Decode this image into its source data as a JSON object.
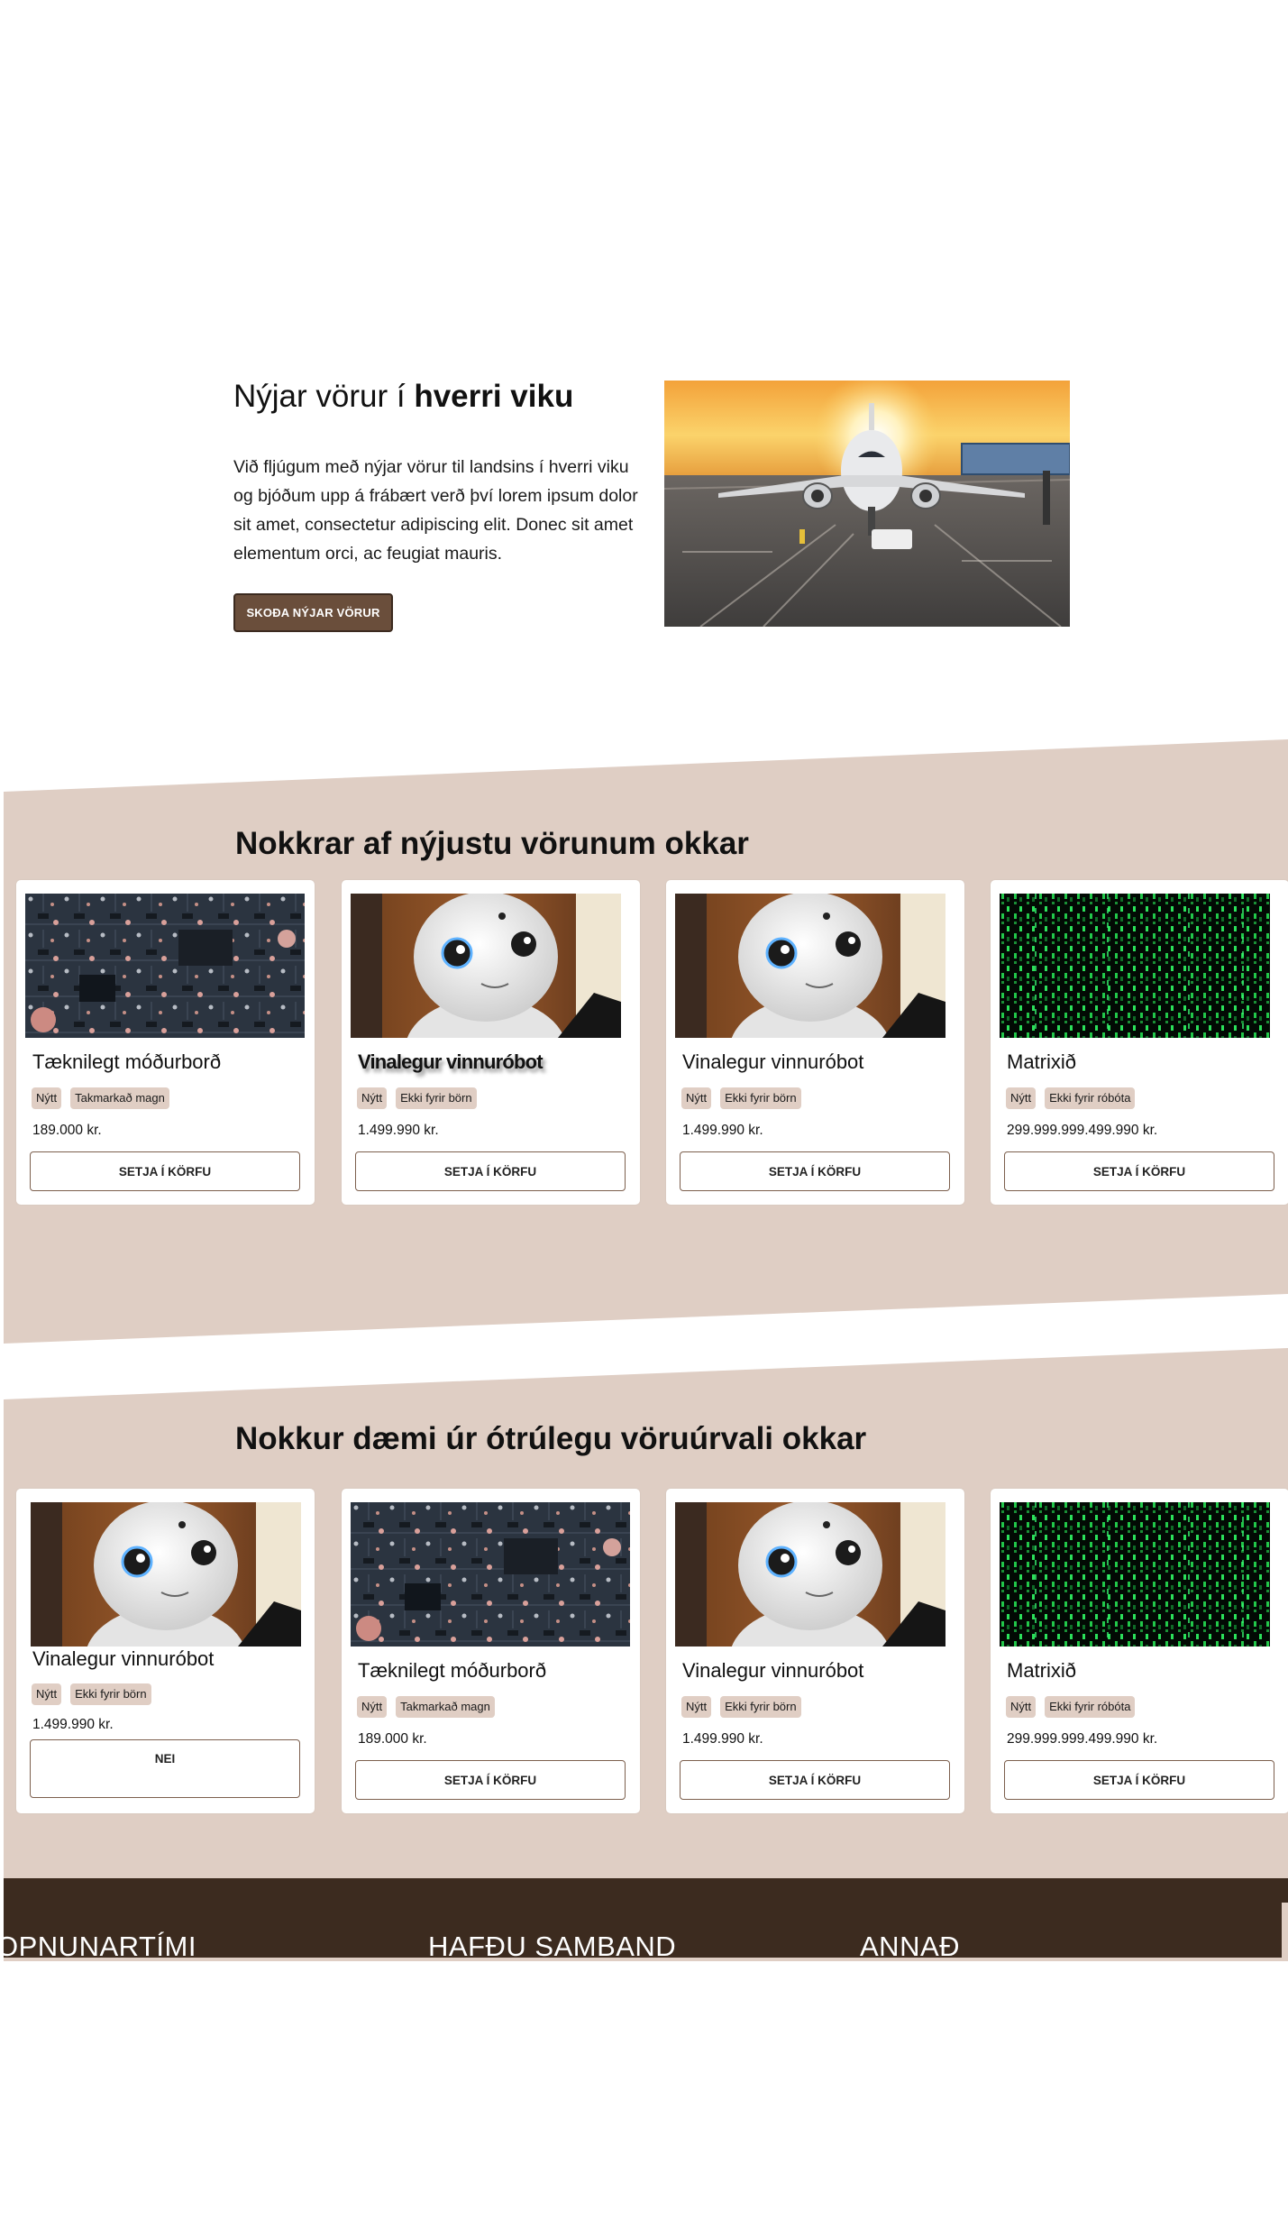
{
  "hero": {
    "title_plain": "Nýjar vörur í ",
    "title_bold": "hverri viku",
    "text": "Við fljúgum með nýjar vörur til landsins í hverri viku og bjóðum upp á frábært verð því lorem ipsum dolor sit amet, consectetur adipiscing elit. Donec sit amet elementum orci, ac feugiat mauris.",
    "button_label": "Skoða nýjar vörur",
    "image": "airplane-at-sunset-photo"
  },
  "colors": {
    "band": "#dfcec4",
    "footer": "#3c2b1f",
    "button_dark": "#6a4e3b",
    "tag_bg": "#e0cec4"
  },
  "newest": {
    "title_plain_1": "Nokkrar af ",
    "title_bold": "nýjustu vörunum",
    "title_plain_2": " okkar",
    "products": [
      {
        "name": "Tæknilegt móðurborð",
        "tags": [
          "Nýtt",
          "Takmarkað magn"
        ],
        "price": "189.000 kr.",
        "button": "Setja í körfu",
        "image": "circuit-board-photo"
      },
      {
        "name": "Vinalegur vinnuróbot",
        "tags": [
          "Nýtt",
          "Ekki fyrir börn"
        ],
        "price": "1.499.990 kr.",
        "button": "Setja í körfu",
        "image": "robot-photo"
      },
      {
        "name": "Vinalegur vinnuróbot",
        "tags": [
          "Nýtt",
          "Ekki fyrir börn"
        ],
        "price": "1.499.990 kr.",
        "button": "Setja í körfu",
        "image": "robot-photo"
      },
      {
        "name": "Matrixið",
        "tags": [
          "Nýtt",
          "Ekki fyrir róbóta"
        ],
        "price": "299.999.999.499.990 kr.",
        "button": "Setja í körfu",
        "image": "matrix-code-photo"
      }
    ]
  },
  "selection": {
    "title": "Nokkur dæmi úr ótrúlegu vöruúrvali okkar",
    "products": [
      {
        "name": "Vinalegur vinnuróbot",
        "tags": [
          "Nýtt",
          "Ekki fyrir börn"
        ],
        "price": "1.499.990 kr.",
        "button": "Nei",
        "image": "robot-photo"
      },
      {
        "name": "Tæknilegt móðurborð",
        "tags": [
          "Nýtt",
          "Takmarkað magn"
        ],
        "price": "189.000 kr.",
        "button": "Setja í körfu",
        "image": "circuit-board-photo"
      },
      {
        "name": "Vinalegur vinnuróbot",
        "tags": [
          "Nýtt",
          "Ekki fyrir börn"
        ],
        "price": "1.499.990 kr.",
        "button": "Setja í körfu",
        "image": "robot-photo"
      },
      {
        "name": "Matrixið",
        "tags": [
          "Nýtt",
          "Ekki fyrir róbóta"
        ],
        "price": "299.999.999.499.990 kr.",
        "button": "Setja í körfu",
        "image": "matrix-code-photo"
      }
    ]
  },
  "footer": {
    "col1": "Opnunartími",
    "col2": "Hafðu samband",
    "col3": "Annað"
  }
}
